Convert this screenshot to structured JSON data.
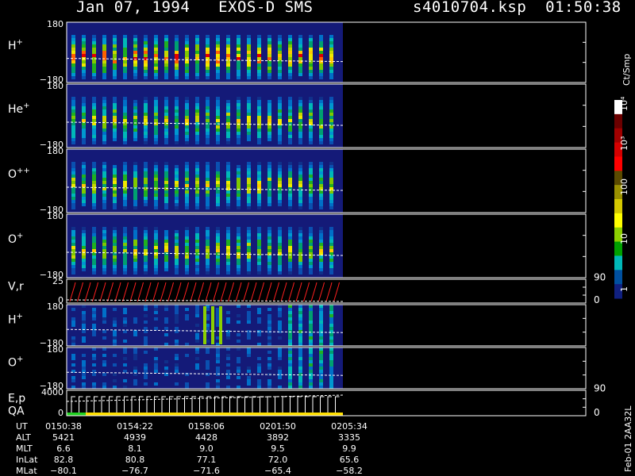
{
  "header": {
    "date_title": "Jan 07, 1994   EXOS-D SMS",
    "file_time": "s4010704.ksp  01:50:38"
  },
  "colorbar": {
    "unit": "Ct/Smp",
    "ticks": [
      "10⁴",
      "10³",
      "100",
      "10",
      "1"
    ],
    "colors": [
      "#ffffff",
      "#6b0000",
      "#a00000",
      "#d40000",
      "#ff0000",
      "#5a4a00",
      "#9a9000",
      "#d4c800",
      "#ffff00",
      "#8ccf00",
      "#00a000",
      "#00b8b8",
      "#0050a0",
      "#102080"
    ]
  },
  "panels": [
    {
      "name": "hplus-angle",
      "label": "H",
      "sup": "+",
      "top": "180",
      "bottom": "−180",
      "right": ""
    },
    {
      "name": "heplus-angle",
      "label": "He",
      "sup": "+",
      "top": "180",
      "bottom": "−180",
      "right": ""
    },
    {
      "name": "oplusplus-angle",
      "label": "O",
      "sup": "++",
      "top": "180",
      "bottom": "−180",
      "right": ""
    },
    {
      "name": "oplus-angle",
      "label": "O",
      "sup": "+",
      "top": "180",
      "bottom": "−180",
      "right": ""
    },
    {
      "name": "vr",
      "label": "V,r",
      "sup": "",
      "top": "25",
      "bottom": "0",
      "right_top": "90",
      "right_bottom": "0"
    },
    {
      "name": "hplus-angle-2",
      "label": "H",
      "sup": "+",
      "top": "180",
      "bottom": "−180",
      "right": ""
    },
    {
      "name": "oplus-angle-2",
      "label": "O",
      "sup": "+",
      "top": "180",
      "bottom": "−180",
      "right": ""
    },
    {
      "name": "ep-qa",
      "label": "E,p",
      "sup": "",
      "label2": "QA",
      "top": "4000",
      "bottom": "0",
      "right_top": "90",
      "right_bottom": "0"
    }
  ],
  "orbit_table": {
    "row_labels": [
      "UT",
      "ALT",
      "MLT",
      "InLat",
      "MLat"
    ],
    "columns": [
      [
        "0150:38",
        "5421",
        "6.6",
        "82.8",
        "−80.1"
      ],
      [
        "0154:22",
        "4939",
        "8.1",
        "80.8",
        "−76.7"
      ],
      [
        "0158:06",
        "4428",
        "9.0",
        "77.1",
        "−71.6"
      ],
      [
        "0201:50",
        "3892",
        "9.5",
        "72.0",
        "−65.4"
      ],
      [
        "0205:34",
        "3335",
        "9.9",
        "65.6",
        "−58.2"
      ]
    ]
  },
  "side_note": "Feb-01 2AA32L"
}
